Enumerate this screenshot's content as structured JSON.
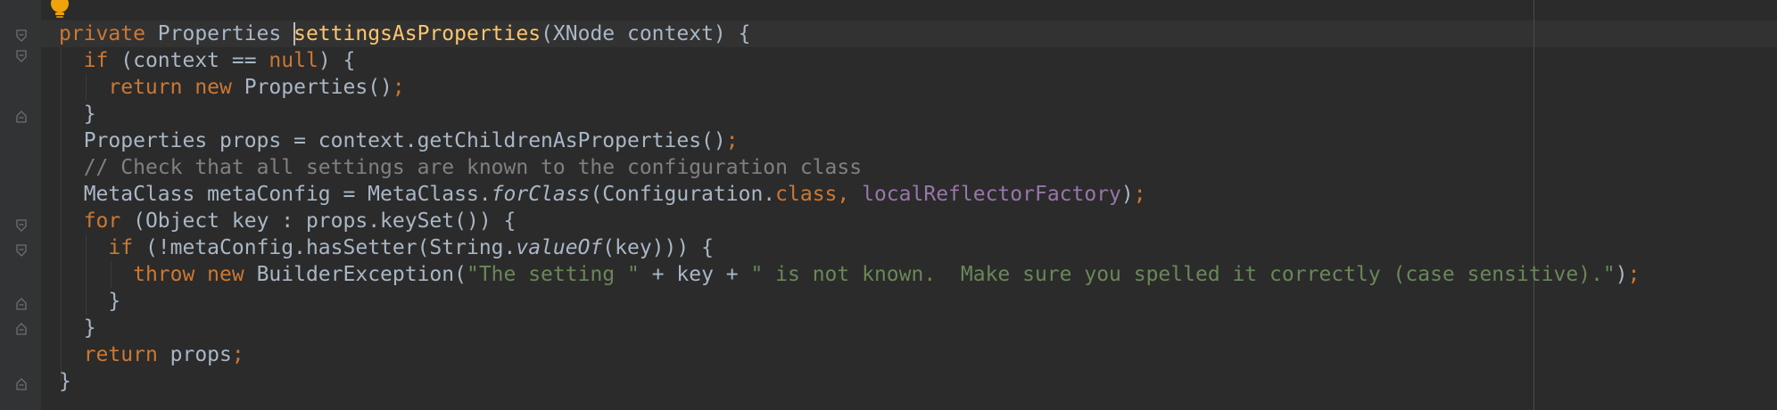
{
  "colors": {
    "background": "#2b2b2b",
    "gutter": "#313335",
    "keyword": "#cc7832",
    "method_declaration": "#ffc66d",
    "comment": "#808080",
    "string": "#6a8759",
    "field": "#9876aa",
    "default_text": "#a9b7c6"
  },
  "icons": {
    "intention": "lightbulb-icon",
    "fold": "fold-marker-icon"
  },
  "code": {
    "l1": {
      "a": "private",
      "b": " Properties ",
      "c": "settingsAsProperties",
      "d": "(XNode context) {"
    },
    "l2": {
      "a": "  ",
      "b": "if",
      "c": " (context == ",
      "d": "null",
      "e": ") {"
    },
    "l3": {
      "a": "    ",
      "b": "return new",
      "c": " Properties()",
      "d": ";"
    },
    "l4": {
      "a": "  }"
    },
    "l5": {
      "a": "  Properties props = context.getChildrenAsProperties()",
      "b": ";"
    },
    "l6": {
      "a": "  ",
      "b": "// Check that all settings are known to the configuration class"
    },
    "l7": {
      "a": "  MetaClass metaConfig = MetaClass.",
      "b": "forClass",
      "c": "(Configuration.",
      "d": "class,",
      "e": " ",
      "f": "localReflectorFactory",
      "g": ")",
      "h": ";"
    },
    "l8": {
      "a": "  ",
      "b": "for",
      "c": " (Object key : props.keySet()) {"
    },
    "l9": {
      "a": "    ",
      "b": "if",
      "c": " (!metaConfig.hasSetter(String.",
      "d": "valueOf",
      "e": "(key))) {"
    },
    "l10": {
      "a": "      ",
      "b": "throw new",
      "c": " BuilderException(",
      "d": "\"The setting \"",
      "e": " + key + ",
      "f": "\" is not known.  Make sure you spelled it correctly (case sensitive).\"",
      "g": ")",
      "h": ";"
    },
    "l11": {
      "a": "    }"
    },
    "l12": {
      "a": "  }"
    },
    "l13": {
      "a": "  ",
      "b": "return",
      "c": " props",
      "d": ";"
    },
    "l14": {
      "a": "}"
    }
  }
}
